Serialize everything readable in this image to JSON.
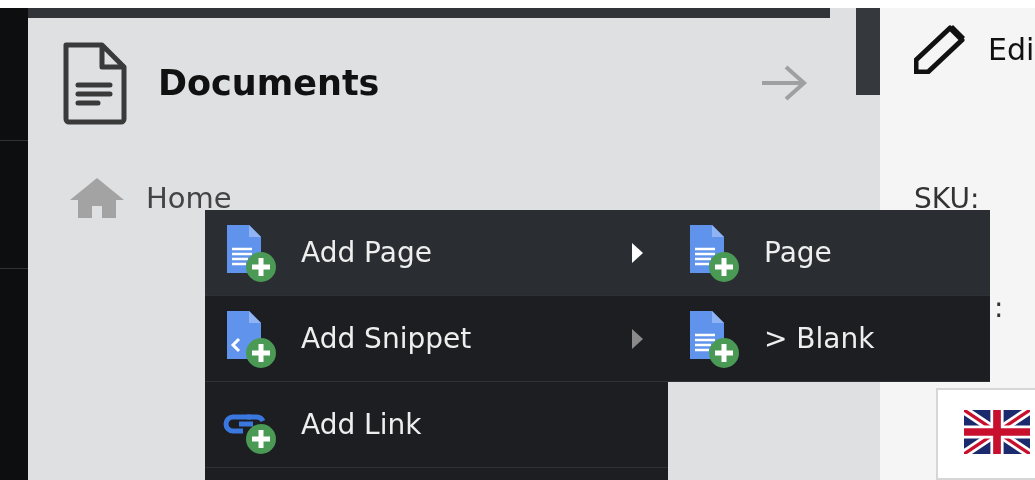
{
  "sidebar": {
    "title": "Documents",
    "items": [
      {
        "label": "Home"
      }
    ]
  },
  "editor": {
    "title": "Edi",
    "fields": [
      {
        "label": "SKU:"
      },
      {
        "label": ":"
      }
    ]
  },
  "context_menu": {
    "items": [
      {
        "label": "Add Page",
        "kind": "page",
        "has_submenu": true,
        "selected": true
      },
      {
        "label": "Add Snippet",
        "kind": "snippet",
        "has_submenu": true,
        "selected": false
      },
      {
        "label": "Add Link",
        "kind": "link",
        "has_submenu": false,
        "selected": false
      }
    ]
  },
  "submenu": {
    "items": [
      {
        "label": "Page",
        "selected": true
      },
      {
        "label": "> Blank",
        "selected": false
      }
    ]
  }
}
